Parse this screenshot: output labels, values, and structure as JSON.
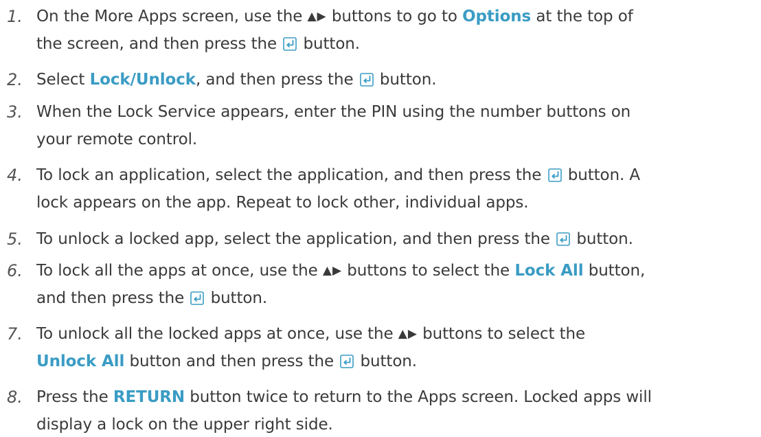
{
  "steps": [
    {
      "number": "1.",
      "lines": [
        [
          {
            "t": "text",
            "v": "On the More Apps screen, use the "
          },
          {
            "t": "arrows",
            "v": "▲▶"
          },
          {
            "t": "text",
            "v": " buttons to go to "
          },
          {
            "t": "hl",
            "v": "Options"
          },
          {
            "t": "text",
            "v": " at the top of"
          }
        ],
        [
          {
            "t": "text",
            "v": "the screen, and then press the "
          },
          {
            "t": "icon",
            "v": "enter-icon"
          },
          {
            "t": "text",
            "v": " button."
          }
        ]
      ]
    },
    {
      "number": "2.",
      "lines": [
        [
          {
            "t": "text",
            "v": "Select "
          },
          {
            "t": "hl",
            "v": "Lock/Unlock"
          },
          {
            "t": "text",
            "v": ", and then press the "
          },
          {
            "t": "icon",
            "v": "enter-icon"
          },
          {
            "t": "text",
            "v": " button."
          }
        ]
      ]
    },
    {
      "number": "3.",
      "lines": [
        [
          {
            "t": "text",
            "v": "When the Lock Service appears, enter the PIN using the number buttons on"
          }
        ],
        [
          {
            "t": "text",
            "v": "your remote control."
          }
        ]
      ]
    },
    {
      "number": "4.",
      "lines": [
        [
          {
            "t": "text",
            "v": "To lock an application, select the application, and then press the "
          },
          {
            "t": "icon",
            "v": "enter-icon"
          },
          {
            "t": "text",
            "v": " button. A"
          }
        ],
        [
          {
            "t": "text",
            "v": "lock appears on the app. Repeat to lock other, individual apps."
          }
        ]
      ]
    },
    {
      "number": "5.",
      "lines": [
        [
          {
            "t": "text",
            "v": "To unlock a locked app, select the application, and then press the "
          },
          {
            "t": "icon",
            "v": "enter-icon"
          },
          {
            "t": "text",
            "v": " button."
          }
        ]
      ]
    },
    {
      "number": "6.",
      "lines": [
        [
          {
            "t": "text",
            "v": "To lock all the apps at once, use the "
          },
          {
            "t": "arrows",
            "v": "▲▶"
          },
          {
            "t": "text",
            "v": " buttons to select the "
          },
          {
            "t": "hl",
            "v": "Lock All"
          },
          {
            "t": "text",
            "v": " button,"
          }
        ],
        [
          {
            "t": "text",
            "v": "and then press the "
          },
          {
            "t": "icon",
            "v": "enter-icon"
          },
          {
            "t": "text",
            "v": " button."
          }
        ]
      ]
    },
    {
      "number": "7.",
      "lines": [
        [
          {
            "t": "text",
            "v": "To unlock all the locked apps at once, use the "
          },
          {
            "t": "arrows",
            "v": "▲▶"
          },
          {
            "t": "text",
            "v": " buttons to select the"
          }
        ],
        [
          {
            "t": "hl",
            "v": "Unlock All"
          },
          {
            "t": "text",
            "v": " button and then press the "
          },
          {
            "t": "icon",
            "v": "enter-icon"
          },
          {
            "t": "text",
            "v": " button."
          }
        ]
      ]
    },
    {
      "number": "8.",
      "lines": [
        [
          {
            "t": "text",
            "v": "Press the "
          },
          {
            "t": "hl",
            "v": "RETURN"
          },
          {
            "t": "text",
            "v": " button twice to return to the Apps screen. Locked apps will"
          }
        ],
        [
          {
            "t": "text",
            "v": "display a lock on the upper right side."
          }
        ]
      ]
    }
  ],
  "colors": {
    "text": "#3a3a3a",
    "highlight": "#3a9cc4",
    "icon": "#3a9cc4"
  }
}
